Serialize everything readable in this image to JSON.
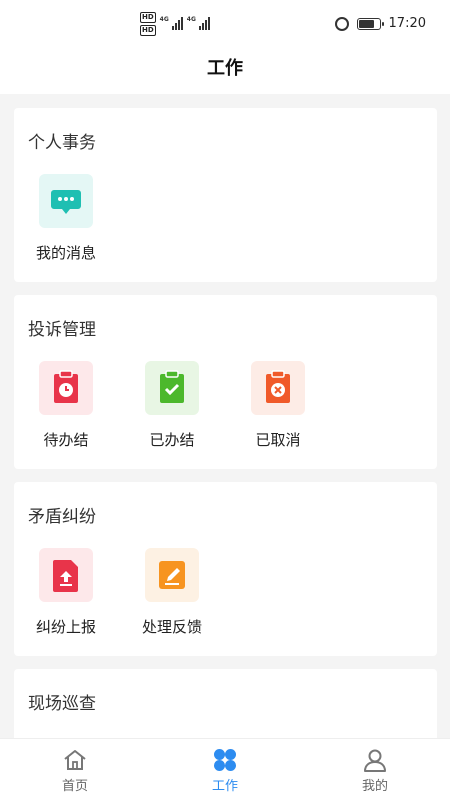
{
  "status_bar": {
    "time": "17:20",
    "network": "4G"
  },
  "header": {
    "title": "工作"
  },
  "sections": [
    {
      "title": "个人事务",
      "items": [
        {
          "label": "我的消息",
          "icon": "message-icon",
          "bg": "#e4f7f5",
          "color": "#1fbfb2"
        }
      ]
    },
    {
      "title": "投诉管理",
      "items": [
        {
          "label": "待办结",
          "icon": "clock-clipboard-icon",
          "bg": "#fde8ea",
          "color": "#e8344a"
        },
        {
          "label": "已办结",
          "icon": "check-clipboard-icon",
          "bg": "#e8f6e4",
          "color": "#4cb82c"
        },
        {
          "label": "已取消",
          "icon": "cancel-clipboard-icon",
          "bg": "#fdece6",
          "color": "#f05a2a"
        }
      ]
    },
    {
      "title": "矛盾纠纷",
      "items": [
        {
          "label": "纠纷上报",
          "icon": "upload-doc-icon",
          "bg": "#fde8ea",
          "color": "#e8344a"
        },
        {
          "label": "处理反馈",
          "icon": "edit-icon",
          "bg": "#fdf1e3",
          "color": "#f79420"
        }
      ]
    },
    {
      "title": "现场巡查",
      "items": []
    }
  ],
  "tabbar": {
    "items": [
      {
        "label": "首页",
        "icon": "home-icon",
        "active": false
      },
      {
        "label": "工作",
        "icon": "grid-icon",
        "active": true
      },
      {
        "label": "我的",
        "icon": "user-icon",
        "active": false
      }
    ],
    "accent": "#2d8cf0"
  }
}
